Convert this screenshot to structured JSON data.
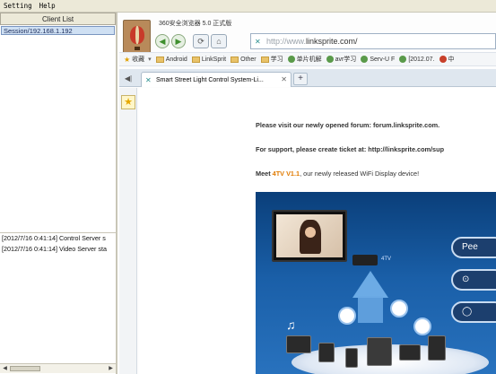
{
  "menubar": {
    "items": [
      "Setting",
      "Help"
    ]
  },
  "client_panel": {
    "header": "Client List",
    "clients": [
      "Session/192.168.1.192"
    ]
  },
  "log": {
    "lines": [
      "[2012/7/16 0:41:14] Control Server s",
      "[2012/7/16 0:41:14] Video Server sta"
    ]
  },
  "browser": {
    "title": "360安全浏览器 5.0 正式版",
    "url_prefix": "http://www.",
    "url_host": "linksprite.com/",
    "bookmarks": [
      {
        "label": "收藏",
        "icon": "star-icon"
      },
      {
        "label": "Android",
        "icon": "folder-icon"
      },
      {
        "label": "LinkSprit",
        "icon": "folder-icon"
      },
      {
        "label": "Other",
        "icon": "folder-icon"
      },
      {
        "label": "学习",
        "icon": "folder-icon"
      },
      {
        "label": "单片机解",
        "icon": "site-icon"
      },
      {
        "label": "avr学习",
        "icon": "site-icon"
      },
      {
        "label": "Serv-U F",
        "icon": "site-icon"
      },
      {
        "label": "[2012.07.",
        "icon": "site-icon"
      },
      {
        "label": "中",
        "icon": "site-icon"
      }
    ],
    "tab_title": "Smart Street Light Control System-Li...",
    "new_tab_label": "+"
  },
  "page": {
    "forum_line": "Please visit  our newly opened  forum: forum.linksprite.com.",
    "support_line": "For support,  please create ticket at: http://linksprite.com/sup",
    "meet_prefix": "Meet ",
    "meet_product": "4TV V1.1",
    "meet_suffix": ", our newly released WiFi Display device!",
    "banner_dongle_label": "4TV",
    "banner_pill_text": "Pee"
  }
}
